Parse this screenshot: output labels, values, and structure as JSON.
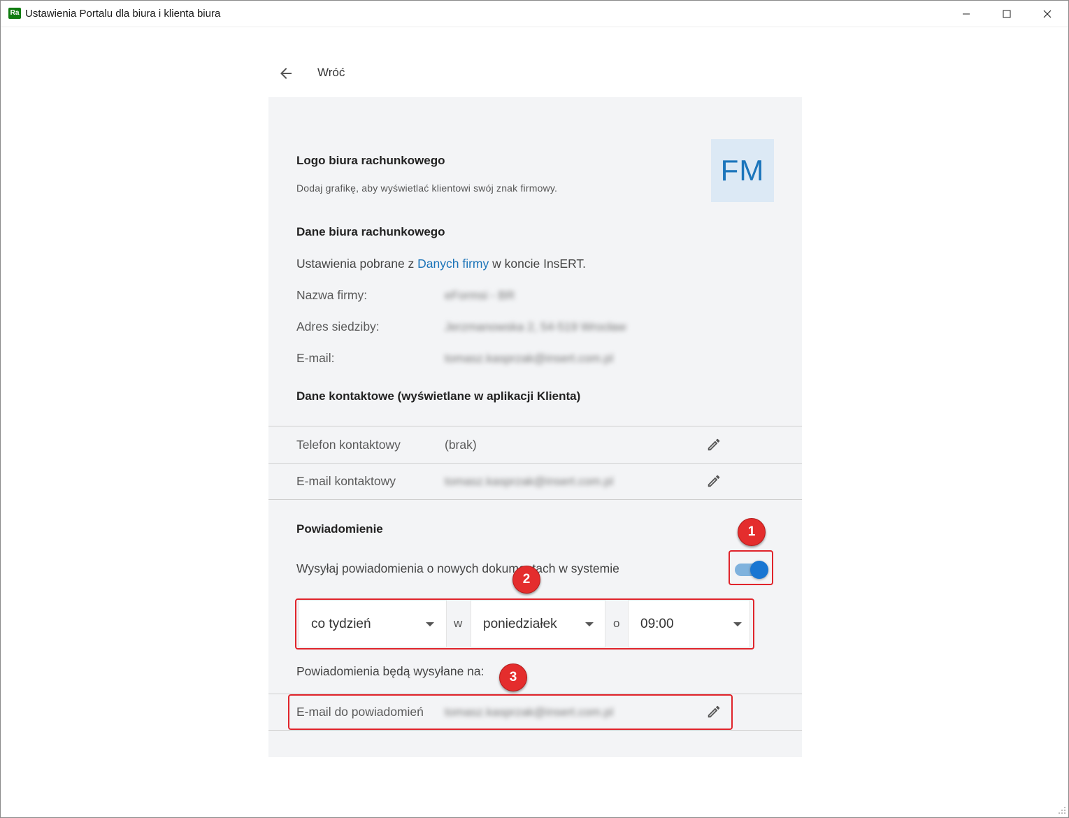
{
  "window": {
    "app_icon_text": "Ra",
    "title": "Ustawienia Portalu dla biura i klienta biura"
  },
  "nav": {
    "back_label": "Wróć"
  },
  "logo_section": {
    "heading": "Logo biura rachunkowego",
    "description": "Dodaj grafikę, aby wyświetlać klientowi swój znak firmowy.",
    "logo_initials": "FM"
  },
  "office_data": {
    "heading": "Dane biura rachunkowego",
    "source_prefix": "Ustawienia pobrane z ",
    "source_link": "Danych firmy",
    "source_suffix": " w koncie InsERT.",
    "fields": [
      {
        "label": "Nazwa firmy:",
        "value": "eFormsi - BR"
      },
      {
        "label": "Adres siedziby:",
        "value": "Jerzmanowska 2, 54-519 Wrocław"
      },
      {
        "label": "E-mail:",
        "value": "tomasz.kasprzak@insert.com.pl"
      }
    ]
  },
  "contact": {
    "heading": "Dane kontaktowe (wyświetlane w aplikacji Klienta)",
    "rows": [
      {
        "label": "Telefon kontaktowy",
        "value": "(brak)"
      },
      {
        "label": "E-mail kontaktowy",
        "value": "tomasz.kasprzak@insert.com.pl"
      }
    ]
  },
  "notifications": {
    "heading": "Powiadomienie",
    "toggle_label": "Wysyłaj powiadomienia o nowych dokumentach w systemie",
    "toggle_on": true,
    "frequency": "co tydzień",
    "sep_w": "w",
    "day": "poniedziałek",
    "sep_o": "o",
    "time": "09:00",
    "recipients_label": "Powiadomienia będą wysyłane na:",
    "email_row_label": "E-mail do powiadomień",
    "email_row_value": "tomasz.kasprzak@insert.com.pl"
  },
  "annotations": {
    "badge_1": "1",
    "badge_2": "2",
    "badge_3": "3",
    "color": "#e0242b"
  },
  "colors": {
    "accent": "#1976d2",
    "link": "#1a73b8",
    "card_bg": "#f3f4f6"
  }
}
